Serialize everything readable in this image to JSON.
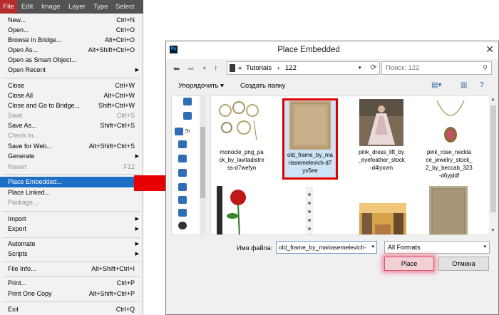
{
  "menubar": {
    "items": [
      "File",
      "Edit",
      "Image",
      "Layer",
      "Type",
      "Select"
    ]
  },
  "file_menu": {
    "items": [
      {
        "label": "New...",
        "shortcut": "Ctrl+N"
      },
      {
        "label": "Open...",
        "shortcut": "Ctrl+O"
      },
      {
        "label": "Browse in Bridge...",
        "shortcut": "Alt+Ctrl+O"
      },
      {
        "label": "Open As...",
        "shortcut": "Alt+Shift+Ctrl+O"
      },
      {
        "label": "Open as Smart Object..."
      },
      {
        "label": "Open Recent",
        "submenu": true
      },
      {
        "label": "Close",
        "shortcut": "Ctrl+W"
      },
      {
        "label": "Close All",
        "shortcut": "Alt+Ctrl+W"
      },
      {
        "label": "Close and Go to Bridge...",
        "shortcut": "Shift+Ctrl+W"
      },
      {
        "label": "Save",
        "shortcut": "Ctrl+S",
        "disabled": true
      },
      {
        "label": "Save As...",
        "shortcut": "Shift+Ctrl+S"
      },
      {
        "label": "Check In...",
        "disabled": true
      },
      {
        "label": "Save for Web...",
        "shortcut": "Alt+Shift+Ctrl+S"
      },
      {
        "label": "Generate",
        "submenu": true
      },
      {
        "label": "Revert",
        "shortcut": "F12",
        "disabled": true
      },
      {
        "label": "Place Embedded...",
        "highlighted": true
      },
      {
        "label": "Place Linked..."
      },
      {
        "label": "Package...",
        "disabled": true
      },
      {
        "label": "Import",
        "submenu": true
      },
      {
        "label": "Export",
        "submenu": true
      },
      {
        "label": "Automate",
        "submenu": true
      },
      {
        "label": "Scripts",
        "submenu": true
      },
      {
        "label": "File Info...",
        "shortcut": "Alt+Shift+Ctrl+I"
      },
      {
        "label": "Print...",
        "shortcut": "Ctrl+P"
      },
      {
        "label": "Print One Copy",
        "shortcut": "Alt+Shift+Ctrl+P"
      },
      {
        "label": "Exit",
        "shortcut": "Ctrl+Q"
      }
    ]
  },
  "dialog": {
    "title": "Place Embedded",
    "app_icon": "Ps",
    "breadcrumb": [
      "«",
      "Tutorials",
      "›",
      "122"
    ],
    "search_placeholder": "Поиск: 122",
    "organize_label": "Упорядочить ▾",
    "new_folder_label": "Создать папку",
    "nav_pane_label": "Эт",
    "files": [
      {
        "name": "monocle_png_pack_by_lavitadistress-d7wefyn",
        "lines": [
          "monocle_png_pa",
          "ck_by_lavitadistre",
          "ss-d7wefyn"
        ]
      },
      {
        "name": "old_frame_by_mariasemelevich-d7yx5ee",
        "lines": [
          "old_frame_by_ma",
          "riasemelevich-d7",
          "yx5ee"
        ],
        "selected": true
      },
      {
        "name": "pink_dress_lift_by_eyefeather_stock-d4iyxvm",
        "lines": [
          "pink_dress_lift_by",
          "_eyefeather_stock",
          "-d4iyxvm"
        ]
      },
      {
        "name": "pink_rose_necklace_jewelry_stock_2_by_beccab_323-d6yjddf",
        "lines": [
          "pink_rose_neckla",
          "ce_jewelry_stock_",
          "2_by_beccab_323",
          "-d6yjddf"
        ]
      }
    ],
    "filename_label": "Имя файла:",
    "filename_value": "old_frame_by_mariasemelevich-",
    "format_value": "All Formats",
    "place_label": "Place",
    "cancel_label": "Отмена"
  },
  "colors": {
    "menubar_bg": "#535353",
    "file_active": "#b32d2d",
    "highlight": "#1c6fc4",
    "annotation_red": "#e10000"
  }
}
